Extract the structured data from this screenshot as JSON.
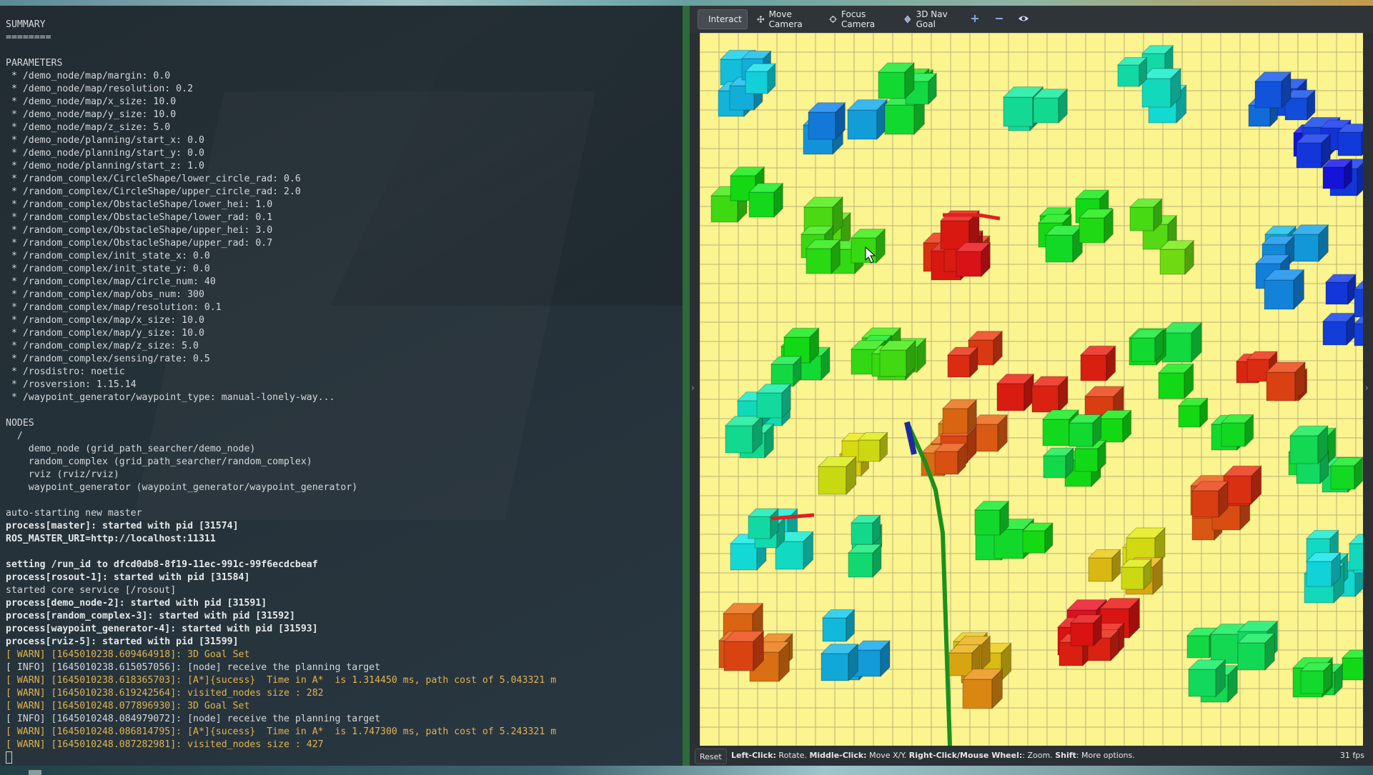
{
  "terminal": {
    "lines": [
      {
        "text": "SUMMARY",
        "style": "info"
      },
      {
        "text": "========",
        "style": "info"
      },
      {
        "text": "",
        "style": "info"
      },
      {
        "text": "PARAMETERS",
        "style": "info"
      },
      {
        "text": " * /demo_node/map/margin: 0.0",
        "style": "info"
      },
      {
        "text": " * /demo_node/map/resolution: 0.2",
        "style": "info"
      },
      {
        "text": " * /demo_node/map/x_size: 10.0",
        "style": "info"
      },
      {
        "text": " * /demo_node/map/y_size: 10.0",
        "style": "info"
      },
      {
        "text": " * /demo_node/map/z_size: 5.0",
        "style": "info"
      },
      {
        "text": " * /demo_node/planning/start_x: 0.0",
        "style": "info"
      },
      {
        "text": " * /demo_node/planning/start_y: 0.0",
        "style": "info"
      },
      {
        "text": " * /demo_node/planning/start_z: 1.0",
        "style": "info"
      },
      {
        "text": " * /random_complex/CircleShape/lower_circle_rad: 0.6",
        "style": "info"
      },
      {
        "text": " * /random_complex/CircleShape/upper_circle_rad: 2.0",
        "style": "info"
      },
      {
        "text": " * /random_complex/ObstacleShape/lower_hei: 1.0",
        "style": "info"
      },
      {
        "text": " * /random_complex/ObstacleShape/lower_rad: 0.1",
        "style": "info"
      },
      {
        "text": " * /random_complex/ObstacleShape/upper_hei: 3.0",
        "style": "info"
      },
      {
        "text": " * /random_complex/ObstacleShape/upper_rad: 0.7",
        "style": "info"
      },
      {
        "text": " * /random_complex/init_state_x: 0.0",
        "style": "info"
      },
      {
        "text": " * /random_complex/init_state_y: 0.0",
        "style": "info"
      },
      {
        "text": " * /random_complex/map/circle_num: 40",
        "style": "info"
      },
      {
        "text": " * /random_complex/map/obs_num: 300",
        "style": "info"
      },
      {
        "text": " * /random_complex/map/resolution: 0.1",
        "style": "info"
      },
      {
        "text": " * /random_complex/map/x_size: 10.0",
        "style": "info"
      },
      {
        "text": " * /random_complex/map/y_size: 10.0",
        "style": "info"
      },
      {
        "text": " * /random_complex/map/z_size: 5.0",
        "style": "info"
      },
      {
        "text": " * /random_complex/sensing/rate: 0.5",
        "style": "info"
      },
      {
        "text": " * /rosdistro: noetic",
        "style": "info"
      },
      {
        "text": " * /rosversion: 1.15.14",
        "style": "info"
      },
      {
        "text": " * /waypoint_generator/waypoint_type: manual-lonely-way...",
        "style": "info"
      },
      {
        "text": "",
        "style": "info"
      },
      {
        "text": "NODES",
        "style": "info"
      },
      {
        "text": "  /",
        "style": "info"
      },
      {
        "text": "    demo_node (grid_path_searcher/demo_node)",
        "style": "info"
      },
      {
        "text": "    random_complex (grid_path_searcher/random_complex)",
        "style": "info"
      },
      {
        "text": "    rviz (rviz/rviz)",
        "style": "info"
      },
      {
        "text": "    waypoint_generator (waypoint_generator/waypoint_generator)",
        "style": "info"
      },
      {
        "text": "",
        "style": "info"
      },
      {
        "text": "auto-starting new master",
        "style": "info"
      },
      {
        "text": "process[master]: started with pid [31574]",
        "style": "bold"
      },
      {
        "text": "ROS_MASTER_URI=http://localhost:11311",
        "style": "bold"
      },
      {
        "text": "",
        "style": "info"
      },
      {
        "text": "setting /run_id to dfcd0db8-8f19-11ec-991c-99f6ecdcbeaf",
        "style": "bold"
      },
      {
        "text": "process[rosout-1]: started with pid [31584]",
        "style": "bold"
      },
      {
        "text": "started core service [/rosout]",
        "style": "info"
      },
      {
        "text": "process[demo_node-2]: started with pid [31591]",
        "style": "bold"
      },
      {
        "text": "process[random_complex-3]: started with pid [31592]",
        "style": "bold"
      },
      {
        "text": "process[waypoint_generator-4]: started with pid [31593]",
        "style": "bold"
      },
      {
        "text": "process[rviz-5]: started with pid [31599]",
        "style": "bold"
      },
      {
        "text": "[ WARN] [1645010238.609464918]: 3D Goal Set",
        "style": "warn"
      },
      {
        "text": "[ INFO] [1645010238.615057056]: [node] receive the planning target",
        "style": "info"
      },
      {
        "text": "[ WARN] [1645010238.618365703]: [A*]{sucess}  Time in A*  is 1.314450 ms, path cost of 5.043321 m",
        "style": "warn"
      },
      {
        "text": "[ WARN] [1645010238.619242564]: visited_nodes size : 282",
        "style": "warn"
      },
      {
        "text": "[ WARN] [1645010248.077896930]: 3D Goal Set",
        "style": "warn"
      },
      {
        "text": "[ INFO] [1645010248.084979072]: [node] receive the planning target",
        "style": "info"
      },
      {
        "text": "[ WARN] [1645010248.086814795]: [A*]{sucess}  Time in A*  is 1.747300 ms, path cost of 5.243321 m",
        "style": "warn"
      },
      {
        "text": "[ WARN] [1645010248.087282981]: visited_nodes size : 427",
        "style": "warn"
      }
    ]
  },
  "rviz": {
    "toolbar": {
      "interact": "Interact",
      "move_camera": "Move Camera",
      "focus_camera": "Focus Camera",
      "nav_goal": "3D Nav Goal"
    },
    "status": {
      "reset": "Reset",
      "left_click_key": "Left-Click:",
      "left_click_val": " Rotate. ",
      "middle_click_key": "Middle-Click:",
      "middle_click_val": " Move X/Y. ",
      "right_click_key": "Right-Click/Mouse Wheel:",
      "right_click_val": ": Zoom. ",
      "shift_key": "Shift",
      "shift_val": ": More options.",
      "fps": "31 fps"
    },
    "colors": {
      "ground": "#fbf48f",
      "grid": "#b9b27a",
      "accent_warn": "#e3b34d"
    }
  }
}
